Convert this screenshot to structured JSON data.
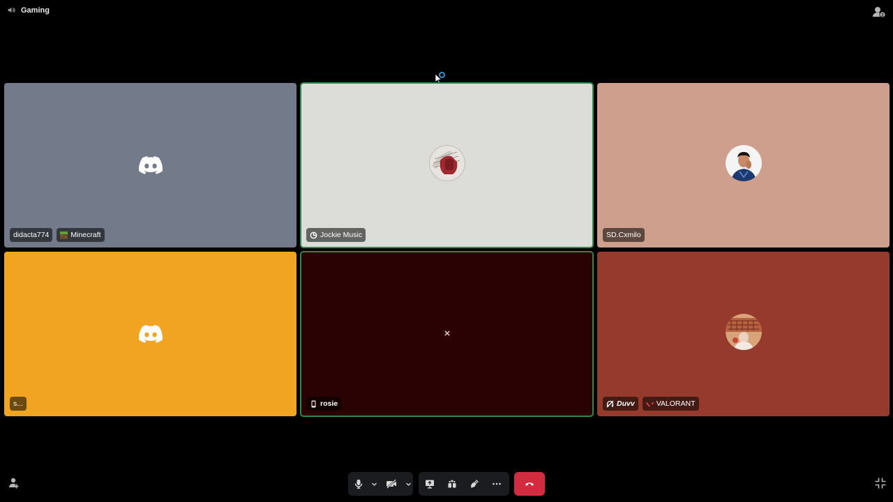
{
  "channel": {
    "name": "Gaming",
    "icon": "speaker-icon"
  },
  "top_right": {
    "icon": "activity-people-icon",
    "badge": "2"
  },
  "tiles": [
    {
      "username": "didacta774",
      "activity": "Minecraft",
      "bg": "#737b8a",
      "avatar": "discord-default-avatar",
      "speaking": false
    },
    {
      "username": "Jockie Music",
      "bg": "#dcdcd8",
      "avatar": "music-bot-avatar",
      "speaking": true,
      "status_icon": "bot-icon"
    },
    {
      "username": "SD.Cxmilo",
      "bg": "#cf9f8d",
      "avatar": "user-photo-avatar",
      "speaking": false
    },
    {
      "username": "s...",
      "bg": "#f0a422",
      "avatar": "discord-default-avatar",
      "speaking": false
    },
    {
      "username": "rosie",
      "bg": "#2a0203",
      "avatar": "small-dark-avatar",
      "speaking": true,
      "status_icon": "mobile-phone-icon"
    },
    {
      "username": "Duvv",
      "activity": "VALORANT",
      "bg": "#963a2e",
      "avatar": "colosseum-photo-avatar",
      "speaking": false,
      "status_icon": "deafened-icon"
    }
  ],
  "controls": {
    "mic": "microphone-icon",
    "mic_options": "chevron-down-icon",
    "camera": "camera-off-icon",
    "camera_options": "chevron-down-icon",
    "screenshare": "screen-share-icon",
    "activities": "activities-icon",
    "soundboard": "soundboard-icon",
    "more": "more-icon",
    "disconnect": "hang-up-icon",
    "invite": "add-person-icon",
    "fullscreen": "exit-fullscreen-icon"
  },
  "colors": {
    "disconnect": "#d32b3f",
    "speaking_outline": "#2a8b4a",
    "control_bg": "#1b1c1f"
  }
}
